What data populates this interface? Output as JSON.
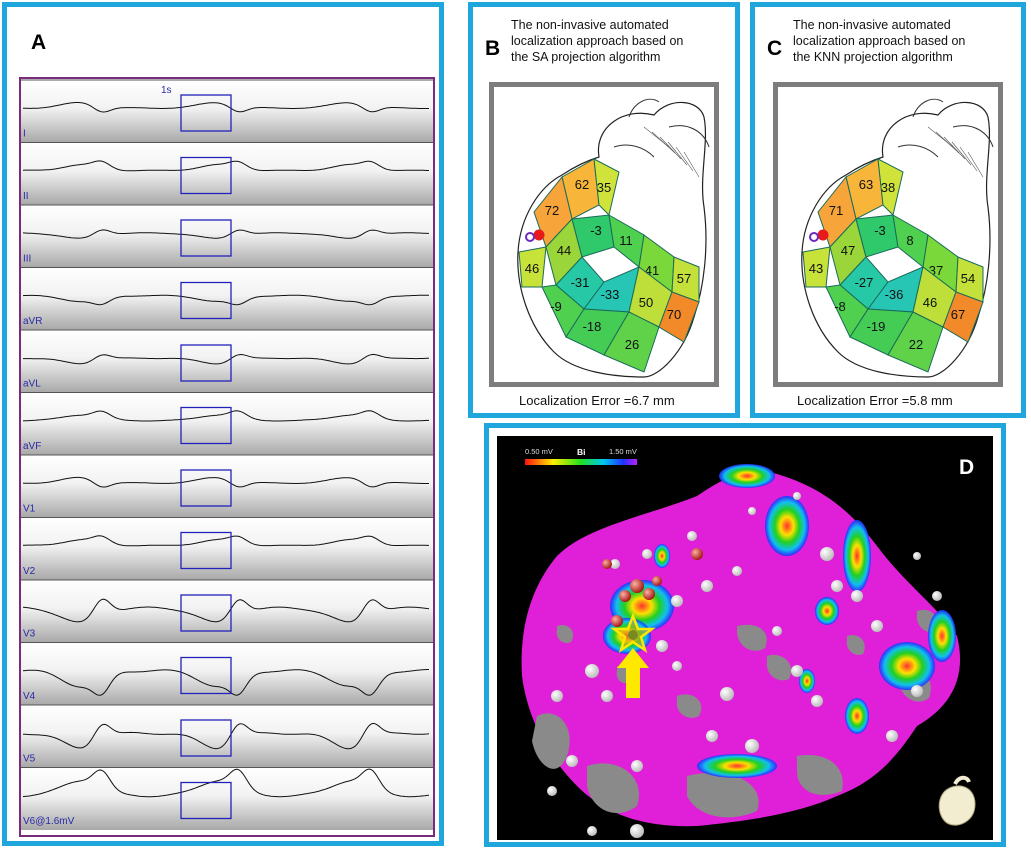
{
  "panels": {
    "a": {
      "letter": "A",
      "scale_label": "1s",
      "leads": [
        "I",
        "II",
        "III",
        "aVR",
        "aVL",
        "aVF",
        "V1",
        "V2",
        "V3",
        "V4",
        "V5",
        "V6@1.6mV"
      ]
    },
    "b": {
      "letter": "B",
      "title_lines": [
        "The non-invasive automated",
        "localization approach based on",
        "the SA projection algorithm"
      ],
      "error": "Localization Error =6.7 mm",
      "segments": [
        "62",
        "72",
        "35",
        "46",
        "44",
        "-3",
        "-31",
        "11",
        "41",
        "57",
        "-9",
        "-33",
        "50",
        "-18",
        "70",
        "26"
      ]
    },
    "c": {
      "letter": "C",
      "title_lines": [
        "The non-invasive automated",
        "localization approach based on",
        "the KNN projection algorithm"
      ],
      "error": "Localization Error =5.8 mm",
      "segments": [
        "63",
        "71",
        "38",
        "43",
        "47",
        "-3",
        "-27",
        "8",
        "37",
        "54",
        "-8",
        "-36",
        "46",
        "-19",
        "67",
        "22"
      ]
    },
    "d": {
      "letter": "D",
      "scale_min": "0.50 mV",
      "scale_mode": "Bi",
      "scale_max": "1.50 mV"
    }
  },
  "colors": {
    "frame": "#1fa6dc",
    "ecg_box": "#2222bb",
    "map_magenta": "#e020d8"
  }
}
